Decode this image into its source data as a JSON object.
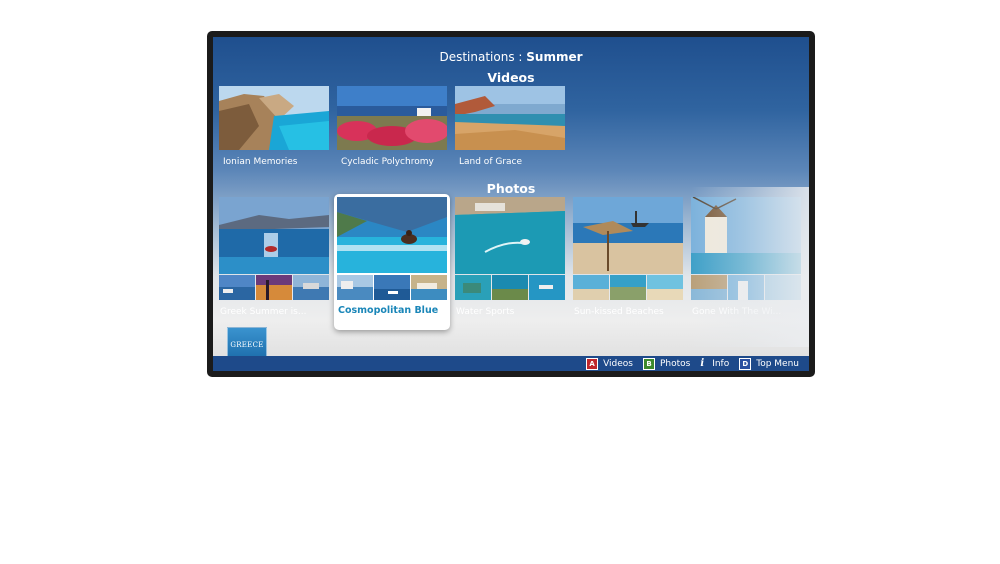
{
  "header": {
    "prefix": "Destinations : ",
    "title": "Summer"
  },
  "sections": {
    "videos": "Videos",
    "photos": "Photos"
  },
  "videos": [
    {
      "label": "Ionian Memories"
    },
    {
      "label": "Cycladic Polychromy"
    },
    {
      "label": "Land of Grace"
    }
  ],
  "photos": [
    {
      "label": "Greek Summer is..."
    },
    {
      "label": "Cosmopolitan Blue"
    },
    {
      "label": "Water Sports"
    },
    {
      "label": "Sun-kissed Beaches"
    },
    {
      "label": "Gone With The Wi..."
    }
  ],
  "logo": {
    "text": "GREECE"
  },
  "bottombar": [
    {
      "key": "A",
      "label": "Videos",
      "color": "#c0282d"
    },
    {
      "key": "B",
      "label": "Photos",
      "color": "#3c8a2e"
    },
    {
      "key": "i",
      "label": "Info",
      "color": ""
    },
    {
      "key": "D",
      "label": "Top Menu",
      "color": "#2a4fa0"
    }
  ],
  "colors": {
    "accent": "#1a86b8",
    "bar": "#1e4a8a"
  }
}
